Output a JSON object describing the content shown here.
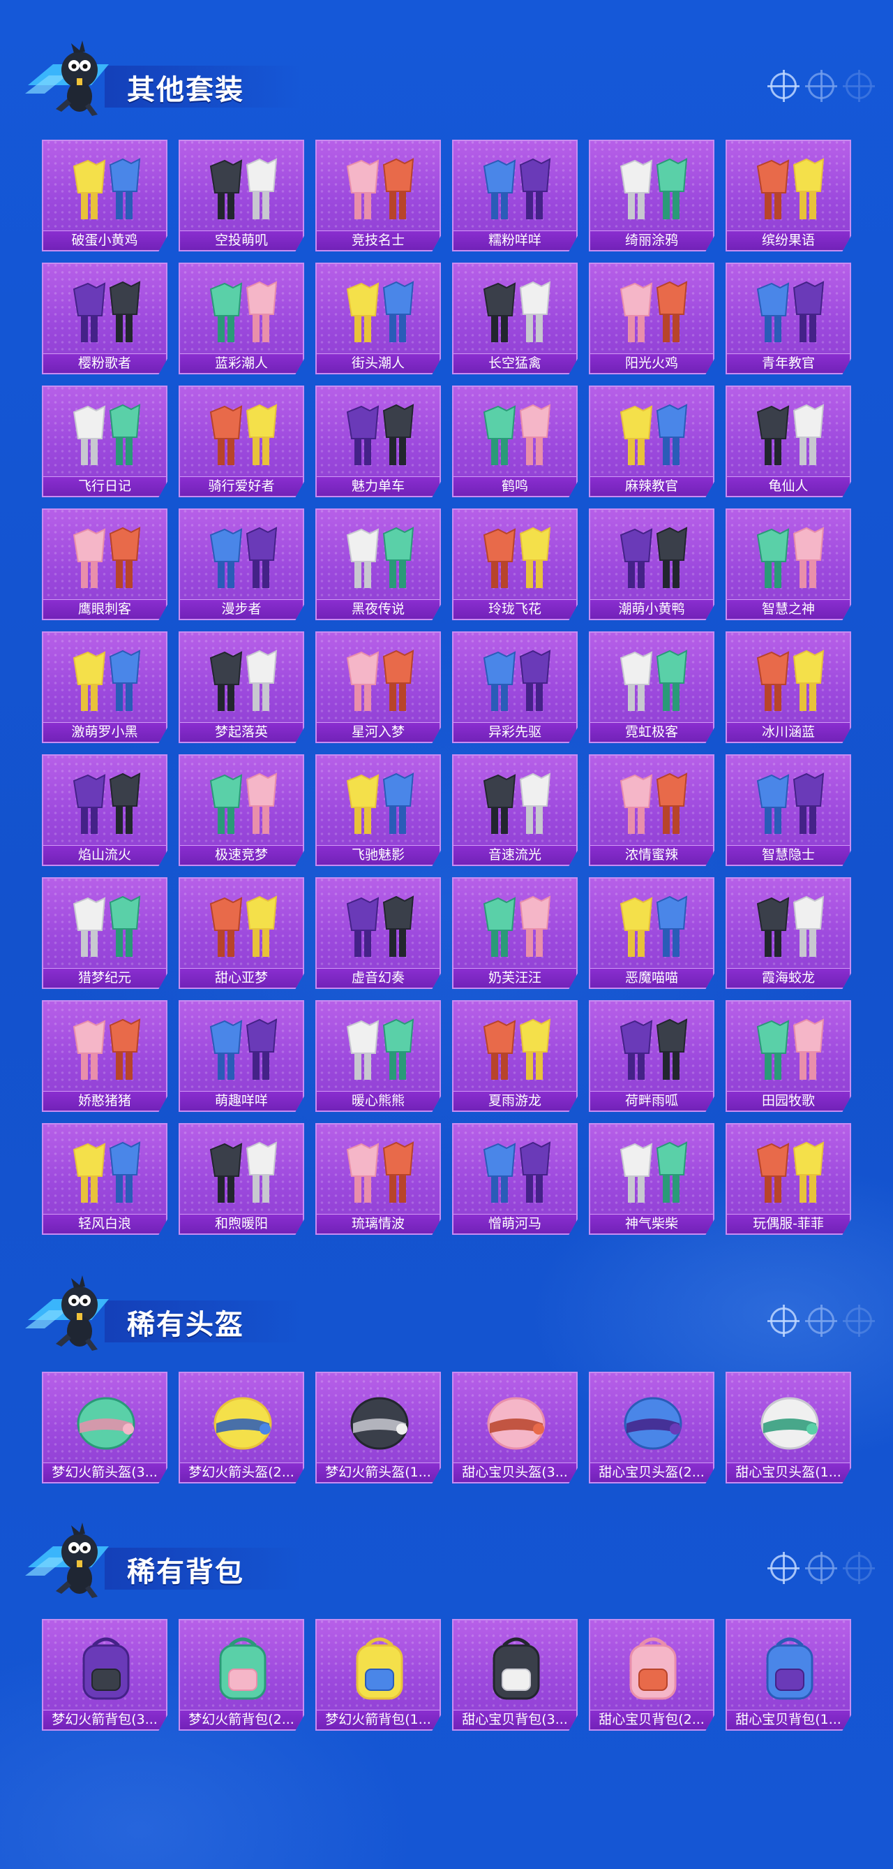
{
  "sections": [
    {
      "title": "其他套装",
      "items": [
        "破蛋小黄鸡",
        "空投萌叽",
        "竞技名士",
        "糯粉咩咩",
        "绮丽涂鸦",
        "缤纷果语",
        "樱粉歌者",
        "蓝彩潮人",
        "街头潮人",
        "长空猛禽",
        "阳光火鸡",
        "青年教官",
        "飞行日记",
        "骑行爱好者",
        "魅力单车",
        "鹤鸣",
        "麻辣教官",
        "龟仙人",
        "鹰眼刺客",
        "漫步者",
        "黑夜传说",
        "玲珑飞花",
        "潮萌小黄鸭",
        "智慧之神",
        "激萌罗小黑",
        "梦起落英",
        "星河入梦",
        "异彩先驱",
        "霓虹极客",
        "冰川涵蓝",
        "焰山流火",
        "极速竞梦",
        "飞驰魅影",
        "音速流光",
        "浓情蜜辣",
        "智慧隐士",
        "猎梦纪元",
        "甜心亚梦",
        "虚音幻奏",
        "奶芙汪汪",
        "恶魔喵喵",
        "霞海蛟龙",
        "娇憨猪猪",
        "萌趣咩咩",
        "暖心熊熊",
        "夏雨游龙",
        "荷畔雨呱",
        "田园牧歌",
        "轻风白浪",
        "和煦暖阳",
        "琉璃情波",
        "憎萌河马",
        "神气柴柴",
        "玩偶服-菲菲"
      ]
    },
    {
      "title": "稀有头盔",
      "items": [
        "梦幻火箭头盔(3...",
        "梦幻火箭头盔(2...",
        "梦幻火箭头盔(1...",
        "甜心宝贝头盔(3...",
        "甜心宝贝头盔(2...",
        "甜心宝贝头盔(1..."
      ]
    },
    {
      "title": "稀有背包",
      "items": [
        "梦幻火箭背包(3...",
        "梦幻火箭背包(2...",
        "梦幻火箭背包(1...",
        "甜心宝贝背包(3...",
        "甜心宝贝背包(2...",
        "甜心宝贝背包(1..."
      ]
    }
  ],
  "icons": {
    "mascot": "chicken-mascot-icon",
    "header_deco": "crosshair-icon"
  },
  "colors": {
    "background": "#1556d4",
    "card": "#a653e3",
    "label_bar": "#7a26c2"
  }
}
